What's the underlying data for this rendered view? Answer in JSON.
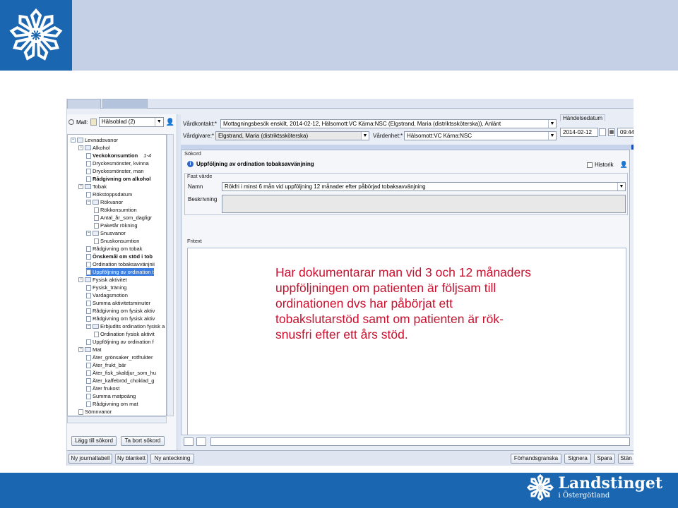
{
  "colors": {
    "brand_blue": "#1b66b0",
    "banner_light": "#c5d0e6",
    "overlay_red": "#c8102e",
    "selection": "#3b7de0"
  },
  "brand": {
    "name": "Landstinget",
    "sub": "i Östergötland"
  },
  "left": {
    "mall_label": "Mall:",
    "mall_value": "Hälsoblad (2)",
    "tree": [
      {
        "label": "Levnadsvanor",
        "depth": 0,
        "kind": "folder"
      },
      {
        "label": "Alkohol",
        "depth": 1,
        "kind": "folder"
      },
      {
        "label": "Veckokonsumtion",
        "depth": 2,
        "kind": "doc",
        "bold": true,
        "extra": "1-4"
      },
      {
        "label": "Dryckesmönster, kvinna",
        "depth": 2,
        "kind": "doc"
      },
      {
        "label": "Dryckesmönster, man",
        "depth": 2,
        "kind": "doc"
      },
      {
        "label": "Rådgivning om alkohol",
        "depth": 2,
        "kind": "doc",
        "bold": true
      },
      {
        "label": "Tobak",
        "depth": 1,
        "kind": "folder"
      },
      {
        "label": "Rökstoppsdatum",
        "depth": 2,
        "kind": "doc"
      },
      {
        "label": "Rökvanor",
        "depth": 2,
        "kind": "folder"
      },
      {
        "label": "Rökkonsumtion",
        "depth": 3,
        "kind": "doc"
      },
      {
        "label": "Antal_år_som_dagligr",
        "depth": 3,
        "kind": "doc"
      },
      {
        "label": "Paketår rökning",
        "depth": 3,
        "kind": "doc"
      },
      {
        "label": "Snusvanor",
        "depth": 2,
        "kind": "folder"
      },
      {
        "label": "Snuskonsumtion",
        "depth": 3,
        "kind": "doc"
      },
      {
        "label": "Rådgivning om tobak",
        "depth": 2,
        "kind": "doc"
      },
      {
        "label": "Önskemål om stöd i tob",
        "depth": 2,
        "kind": "doc",
        "bold": true
      },
      {
        "label": "Ordination tobaksavvänjnii",
        "depth": 2,
        "kind": "doc"
      },
      {
        "label": "Uppföljning av ordination t",
        "depth": 2,
        "kind": "doc",
        "selected": true
      },
      {
        "label": "Fysisk aktivitet",
        "depth": 1,
        "kind": "folder"
      },
      {
        "label": "Fysisk_träning",
        "depth": 2,
        "kind": "doc"
      },
      {
        "label": "Vardagsmotion",
        "depth": 2,
        "kind": "doc"
      },
      {
        "label": "Summa aktivitetsminuter",
        "depth": 2,
        "kind": "doc"
      },
      {
        "label": "Rådgivning om fysisk aktiv",
        "depth": 2,
        "kind": "doc"
      },
      {
        "label": "Rådgivning om fysisk aktiv",
        "depth": 2,
        "kind": "doc"
      },
      {
        "label": "Erbjudits ordination fysisk a",
        "depth": 2,
        "kind": "folder"
      },
      {
        "label": "Ordination fysisk aktivit",
        "depth": 3,
        "kind": "doc"
      },
      {
        "label": "Uppföljning av ordination f",
        "depth": 2,
        "kind": "doc"
      },
      {
        "label": "Mat",
        "depth": 1,
        "kind": "folder"
      },
      {
        "label": "Äter_grönsaker_rotfrukter",
        "depth": 2,
        "kind": "doc"
      },
      {
        "label": "Äter_frukt_bär",
        "depth": 2,
        "kind": "doc"
      },
      {
        "label": "Äter_fisk_skaldjur_som_hu",
        "depth": 2,
        "kind": "doc"
      },
      {
        "label": "Äter_kaffebröd_choklad_g",
        "depth": 2,
        "kind": "doc"
      },
      {
        "label": "Äter frukost",
        "depth": 2,
        "kind": "doc"
      },
      {
        "label": "Summa matpoäng",
        "depth": 2,
        "kind": "doc"
      },
      {
        "label": "Rådgivning om mat",
        "depth": 2,
        "kind": "doc"
      },
      {
        "label": "Sömnvanor",
        "depth": 1,
        "kind": "doc"
      }
    ],
    "add_button": "Lägg till sökord",
    "remove_button": "Ta bort sökord"
  },
  "header": {
    "vardkontakt_label": "Vårdkontakt:*",
    "vardkontakt_value": "Mottagningsbesök enskilt, 2014-02-12, Hälsomott:VC Kärna:NSC (Elgstrand, Maria (distriktssköterska)), Anlänt",
    "vardgivare_label": "Vårdgivare:*",
    "vardgivare_value": "Elgstrand, Maria (distriktssköterska)",
    "vardenhet_label": "Vårdenhet:*",
    "vardenhet_value": "Hälsomott:VC Kärna:NSC",
    "handelsedatum_label": "Händelsedatum",
    "date_value": "2014-02-12",
    "time_value": "09:44"
  },
  "sokord": {
    "section_label": "Sökord",
    "title": "Uppföljning av ordination tobaksavvänjning",
    "historik_label": "Historik",
    "fast_varde_label": "Fast värde",
    "namn_label": "Namn",
    "namn_value": "Rökfri i minst 6 mån vid uppföljning 12 månader efter påbörjad tobaksavvänjning",
    "beskrivning_label": "Beskrivning",
    "fritext_label": "Fritext"
  },
  "bottom": {
    "ny_journaltabell": "Ny journaltabell",
    "ny_blankett": "Ny blankett",
    "ny_anteckning": "Ny anteckning",
    "forhandsgranska": "Förhandsgranska",
    "signera": "Signera",
    "spara": "Spara",
    "stang": "Stän"
  },
  "overlay": {
    "lines": [
      "Har dokumentarar man vid 3 och 12 månaders",
      "uppföljningen om patienten är följsam till",
      "ordinationen dvs har påbörjat ett",
      "tobakslutarstöd  samt om patienten är rök-",
      "snusfri efter ett års stöd."
    ]
  }
}
